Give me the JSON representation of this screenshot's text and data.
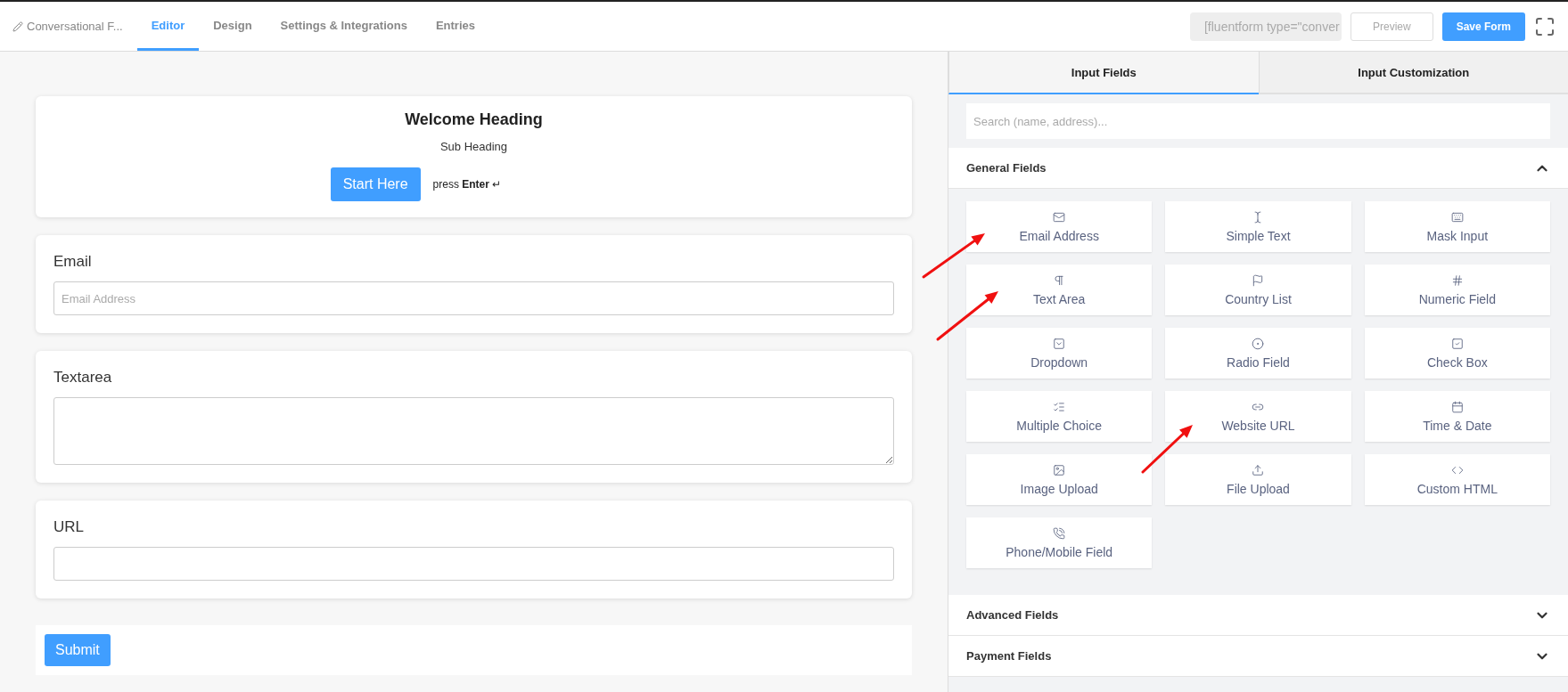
{
  "header": {
    "form_name": "Conversational F...",
    "tabs": [
      {
        "label": "Editor",
        "selected": true
      },
      {
        "label": "Design",
        "selected": false
      },
      {
        "label": "Settings & Integrations",
        "selected": false
      },
      {
        "label": "Entries",
        "selected": false
      }
    ],
    "shortcode": "[fluentform type=\"conver",
    "preview": "Preview",
    "save": "Save Form"
  },
  "form": {
    "welcome": {
      "heading": "Welcome Heading",
      "subheading": "Sub Heading",
      "button": "Start Here",
      "hint": "press **Enter** ↵"
    },
    "questions": [
      {
        "kind": "input",
        "label": "Email",
        "placeholder": "Email Address"
      },
      {
        "kind": "textarea",
        "label": "Textarea"
      },
      {
        "kind": "input",
        "label": "URL"
      }
    ],
    "submit": "Submit"
  },
  "panel": {
    "tabs": [
      {
        "label": "Input Fields",
        "selected": true
      },
      {
        "label": "Input Customization",
        "selected": false
      }
    ],
    "search": {
      "placeholder": "Search (name, address)..."
    },
    "sections": [
      {
        "title": "General Fields",
        "expanded": true,
        "fields": [
          {
            "kind": "email",
            "label": "Email Address"
          },
          {
            "kind": "text",
            "label": "Simple Text"
          },
          {
            "kind": "mask",
            "label": "Mask Input"
          },
          {
            "kind": "textarea",
            "label": "Text Area"
          },
          {
            "kind": "country",
            "label": "Country List"
          },
          {
            "kind": "number",
            "label": "Numeric Field"
          },
          {
            "kind": "dropdown",
            "label": "Dropdown"
          },
          {
            "kind": "radio",
            "label": "Radio Field"
          },
          {
            "kind": "checkbox",
            "label": "Check Box"
          },
          {
            "kind": "multiple",
            "label": "Multiple Choice"
          },
          {
            "kind": "url",
            "label": "Website URL"
          },
          {
            "kind": "date",
            "label": "Time & Date"
          },
          {
            "kind": "image",
            "label": "Image Upload"
          },
          {
            "kind": "file",
            "label": "File Upload"
          },
          {
            "kind": "html",
            "label": "Custom HTML"
          },
          {
            "kind": "phone",
            "label": "Phone/Mobile Field"
          }
        ]
      },
      {
        "title": "Advanced Fields",
        "expanded": false
      },
      {
        "title": "Payment Fields",
        "expanded": false
      }
    ]
  }
}
